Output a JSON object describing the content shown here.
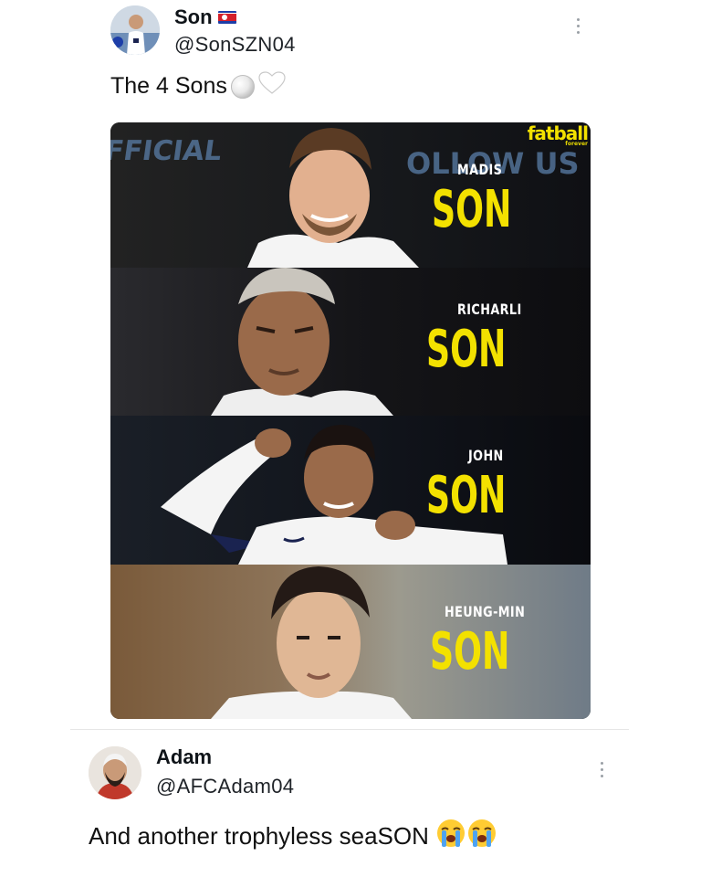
{
  "tweet": {
    "author_name": "Son",
    "flag_icon": "north-korea-flag-icon",
    "handle": "@SonSZN04",
    "text": "The 4 Sons",
    "emojis": [
      "white-ball-emoji",
      "white-heart-emoji"
    ],
    "image": {
      "logo_text": "fatball",
      "logo_subtext": "forever",
      "background_texts": [
        "FFICIAL",
        "OLLOW US"
      ],
      "panels": [
        {
          "first": "MADIS",
          "last": "SON"
        },
        {
          "first": "RICHARLI",
          "last": "SON"
        },
        {
          "first": "JOHN",
          "last": "SON"
        },
        {
          "first": "HEUNG-MIN",
          "last": "SON"
        }
      ]
    }
  },
  "reply": {
    "author_name": "Adam",
    "handle": "@AFCAdam04",
    "text": "And another trophyless seaSON",
    "emojis": [
      "loudly-crying-face-emoji",
      "loudly-crying-face-emoji"
    ]
  },
  "colors": {
    "accent_yellow": "#f3e100",
    "kit_white": "#f4f4f4",
    "kit_navy": "#1a2350"
  }
}
